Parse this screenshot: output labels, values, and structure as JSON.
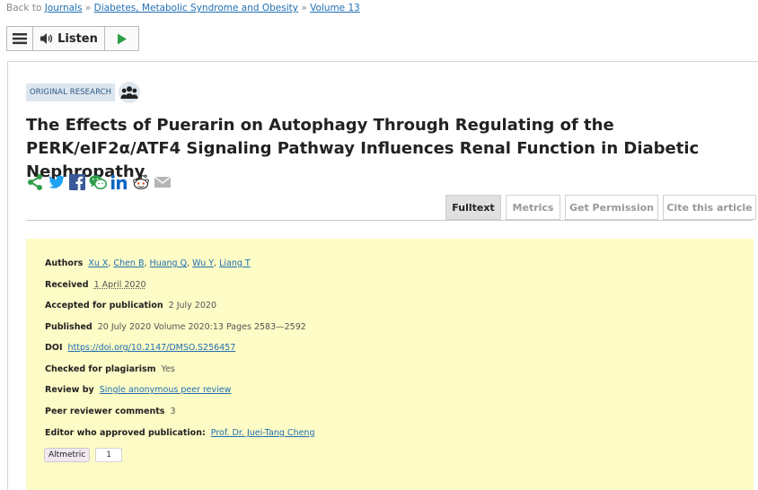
{
  "breadcrumb": {
    "prefix": "Back to",
    "items": [
      "Journals",
      "Diabetes, Metabolic Syndrome and Obesity",
      "Volume 13"
    ],
    "separator": "»"
  },
  "listen_bar": {
    "menu_icon": "hamburger-icon",
    "speaker_icon": "speaker-icon",
    "listen_label": "Listen",
    "play_icon": "play-icon"
  },
  "article": {
    "type_badge": "ORIGINAL RESEARCH",
    "title": "The Effects of Puerarin on Autophagy Through Regulating of the PERK/eIF2α/ATF4 Signaling Pathway Influences Renal Function in Diabetic Nephropathy"
  },
  "share_icons": [
    "share-icon",
    "twitter-icon",
    "facebook-icon",
    "wechat-icon",
    "linkedin-icon",
    "reddit-icon",
    "email-icon"
  ],
  "tabs": [
    {
      "label": "Fulltext",
      "active": true
    },
    {
      "label": "Metrics",
      "active": false
    },
    {
      "label": "Get Permission",
      "active": false
    },
    {
      "label": "Cite this article",
      "active": false
    }
  ],
  "meta": {
    "authors_label": "Authors",
    "authors": [
      "Xu X",
      "Chen B",
      "Huang Q",
      "Wu Y",
      "Liang T"
    ],
    "received_label": "Received",
    "received": "1 April 2020",
    "accepted_label": "Accepted for publication",
    "accepted": "2 July 2020",
    "published_label": "Published",
    "published": "20 July 2020 Volume 2020:13 Pages 2583—2592",
    "doi_label": "DOI",
    "doi": "https://doi.org/10.2147/DMSO.S256457",
    "plagiarism_label": "Checked for plagiarism",
    "plagiarism": "Yes",
    "review_label": "Review by",
    "review": "Single anonymous peer review",
    "comments_label": "Peer reviewer comments",
    "comments": "3",
    "editor_label": "Editor who approved publication:",
    "editor": "Prof. Dr. Juei-Tang Cheng"
  },
  "altmetric": {
    "label": "Altmetric",
    "count": "1"
  },
  "colors": {
    "link": "#1f6fb2",
    "meta_bg": "#fdfbc6",
    "share_green": "#2e9e48",
    "twitter": "#1da1f2",
    "facebook": "#3b5998",
    "linkedin": "#0a66c2"
  }
}
